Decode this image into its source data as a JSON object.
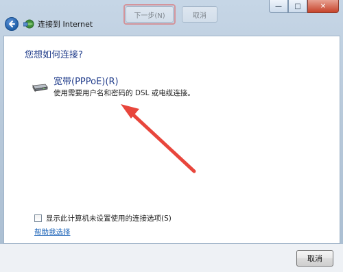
{
  "background_window": {
    "next_button_label": "下一步(N)",
    "cancel_button_label": "取消"
  },
  "window": {
    "title": "连接到 Internet",
    "caption_buttons": {
      "minimize_glyph": "—",
      "maximize_glyph": "□",
      "close_glyph": "✕"
    }
  },
  "content": {
    "question": "您想如何连接?",
    "option": {
      "title": "宽带(PPPoE)(R)",
      "description": "使用需要用户名和密码的 DSL 或电缆连接。",
      "icon": "modem-icon"
    },
    "show_options_checkbox": {
      "label": "显示此计算机未设置使用的连接选项(S)",
      "checked": false
    },
    "help_link": "帮助我选择"
  },
  "footer": {
    "cancel_label": "取消"
  },
  "colors": {
    "heading_blue": "#1f3b8a",
    "link_blue": "#1b63b8",
    "annotation_red": "#e8463c"
  }
}
